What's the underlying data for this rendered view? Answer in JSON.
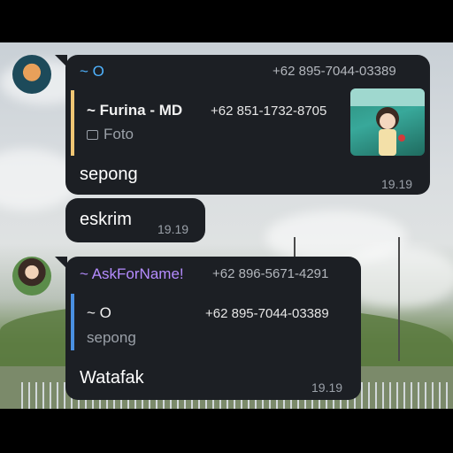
{
  "messages": [
    {
      "sender_name": "~ O",
      "sender_phone": "+62 895-7044-03389",
      "reply": {
        "name": "~ Furina - MD",
        "phone": "+62 851-1732-8705",
        "subtitle": "Foto",
        "subtitle_icon": "image-icon"
      },
      "text": "sepong",
      "time": "19.19"
    },
    {
      "text": "eskrim",
      "time": "19.19"
    },
    {
      "sender_name": "~ AskForName!",
      "sender_phone": "+62 896-5671-4291",
      "reply": {
        "name": "~ O",
        "phone": "+62 895-7044-03389",
        "subtitle": "sepong"
      },
      "text": "Watafak",
      "time": "19.19"
    }
  ],
  "colors": {
    "bubble": "#1c1f24",
    "sender1": "#4fb3ff",
    "sender2": "#b58cff",
    "reply_bar1": "#f0c674",
    "reply_bar2": "#4a90e2",
    "meta": "#9aa0a8"
  }
}
